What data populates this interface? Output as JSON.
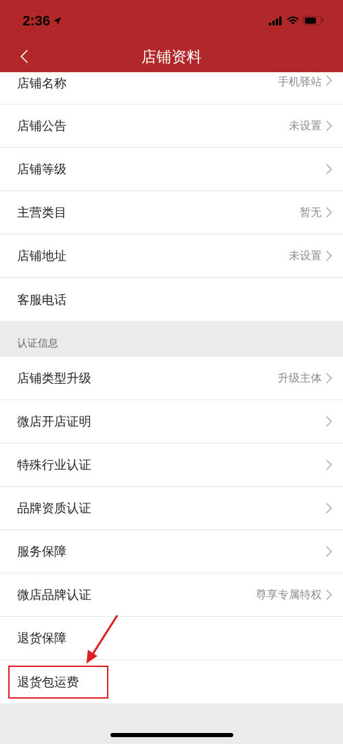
{
  "status_bar": {
    "time": "2:36"
  },
  "nav": {
    "title": "店铺资料"
  },
  "sections": [
    {
      "rows": [
        {
          "label": "店铺名称",
          "value": "手机驿站",
          "chevron": true,
          "highlighted": false
        },
        {
          "label": "店铺公告",
          "value": "未设置",
          "chevron": true,
          "highlighted": false
        },
        {
          "label": "店铺等级",
          "chevron": true,
          "highlighted": false
        },
        {
          "label": "主营类目",
          "value": "暂无",
          "chevron": true,
          "highlighted": false
        },
        {
          "label": "店铺地址",
          "value": "未设置",
          "chevron": true,
          "highlighted": false
        },
        {
          "label": "客服电话",
          "chevron": false,
          "highlighted": false
        }
      ]
    },
    {
      "header": "认证信息",
      "rows": [
        {
          "label": "店铺类型升级",
          "value": "升级主体",
          "chevron": true,
          "highlighted": false
        },
        {
          "label": "微店开店证明",
          "chevron": true,
          "highlighted": false
        },
        {
          "label": "特殊行业认证",
          "chevron": true,
          "highlighted": false
        },
        {
          "label": "品牌资质认证",
          "chevron": true,
          "highlighted": false
        },
        {
          "label": "服务保障",
          "chevron": true,
          "highlighted": false
        },
        {
          "label": "微店品牌认证",
          "value": "尊享专属特权",
          "chevron": true,
          "highlighted": false
        },
        {
          "label": "退货保障",
          "chevron": false,
          "highlighted": false
        },
        {
          "label": "退货包运费",
          "chevron": false,
          "highlighted": true
        }
      ]
    }
  ]
}
